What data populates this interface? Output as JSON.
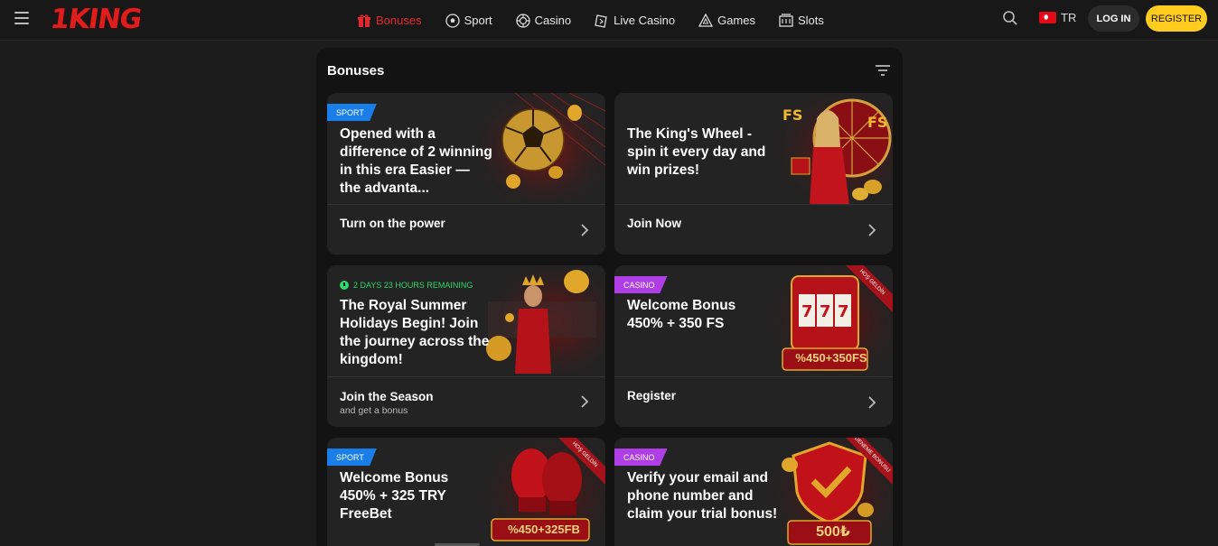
{
  "header": {
    "logo": "1KING",
    "nav": [
      {
        "label": "Bonuses",
        "icon": "gift-icon",
        "active": true
      },
      {
        "label": "Sport",
        "icon": "soccer-ball-icon"
      },
      {
        "label": "Casino",
        "icon": "casino-chip-icon"
      },
      {
        "label": "Live Casino",
        "icon": "live-casino-icon"
      },
      {
        "label": "Games",
        "icon": "games-icon"
      },
      {
        "label": "Slots",
        "icon": "slots-icon"
      }
    ],
    "language": "TR",
    "login_label": "LOG IN",
    "register_label": "REGISTER"
  },
  "panel": {
    "title": "Bonuses",
    "cards": [
      {
        "badge": "SPORT",
        "text": "Opened with a difference of 2 winning in this era Easier — the advanta...",
        "cta": "Turn on the power"
      },
      {
        "text": "The King's Wheel - spin it every day and win prizes!",
        "cta": "Join Now"
      },
      {
        "timer": "2 DAYS 23 HOURS REMAINING",
        "text": "The Royal Summer Holidays Begin! Join the journey across the kingdom!",
        "cta": "Join the Season",
        "cta_sub": "and get a bonus"
      },
      {
        "badge": "CASINO",
        "text": "Welcome Bonus 450% + 350 FS",
        "cta": "Register",
        "ribbon": "HOŞ GELDİN",
        "promo": "%450+350FS"
      },
      {
        "badge": "SPORT",
        "text": "Welcome Bonus 450% + 325 TRY FreeBet",
        "ribbon": "HOŞ GELDİN",
        "promo": "%450+325FB"
      },
      {
        "badge": "CASINO",
        "text": "Verify your email and phone number and claim your trial bonus!",
        "ribbon": "DENEME BONUSU",
        "promo": "500₺"
      }
    ]
  },
  "colors": {
    "accent_red": "#e8262d",
    "register_yellow": "#ffcc1f",
    "sport_badge": "#1a7ee8",
    "casino_badge": "#b03ee6",
    "timer_green": "#2ed86a"
  }
}
